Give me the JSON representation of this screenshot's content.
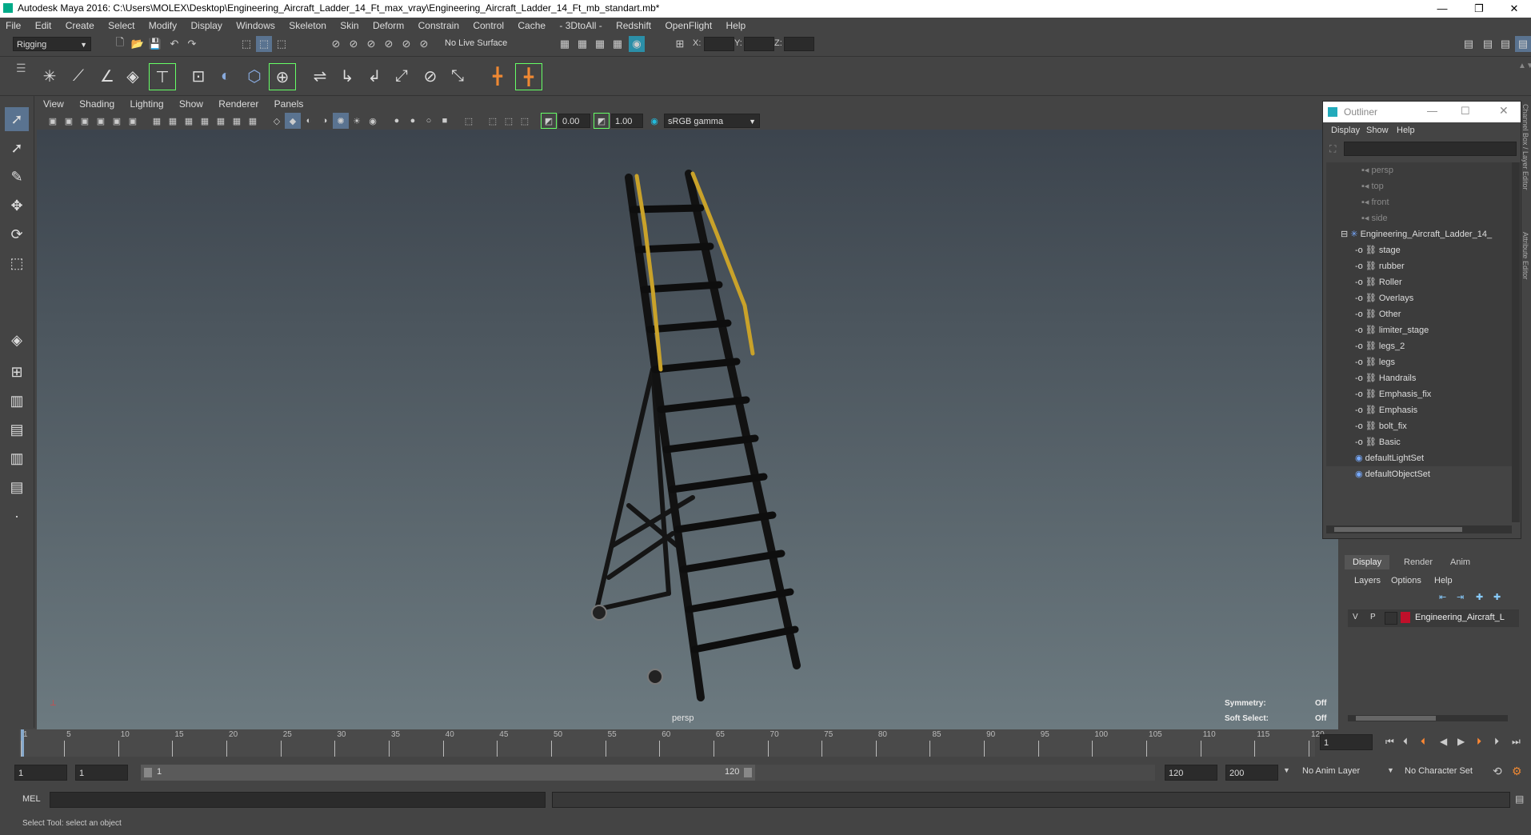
{
  "window": {
    "title": "Autodesk Maya 2016: C:\\Users\\MOLEX\\Desktop\\Engineering_Aircraft_Ladder_14_Ft_max_vray\\Engineering_Aircraft_Ladder_14_Ft_mb_standart.mb*",
    "minimize": "—",
    "restore": "❐",
    "close": "✕"
  },
  "menubar": [
    "File",
    "Edit",
    "Create",
    "Select",
    "Modify",
    "Display",
    "Windows",
    "Skeleton",
    "Skin",
    "Deform",
    "Constrain",
    "Control",
    "Cache",
    "- 3DtoAll -",
    "Redshift",
    "OpenFlight",
    "Help"
  ],
  "statusline": {
    "menuset": "Rigging",
    "live_surface": "No Live Surface",
    "x_label": "X:",
    "y_label": "Y:",
    "z_label": "Z:"
  },
  "panel": {
    "menus": [
      "View",
      "Shading",
      "Lighting",
      "Show",
      "Renderer",
      "Panels"
    ],
    "exposure": "0.00",
    "gamma": "1.00",
    "colorspace": "sRGB gamma"
  },
  "viewport": {
    "camera": "persp",
    "symmetry_label": "Symmetry:",
    "symmetry_value": "Off",
    "soft_select_label": "Soft Select:",
    "soft_select_value": "Off"
  },
  "outliner": {
    "title": "Outliner",
    "menus": [
      "Display",
      "Show",
      "Help"
    ],
    "cameras": [
      "persp",
      "top",
      "front",
      "side"
    ],
    "group": "Engineering_Aircraft_Ladder_14_",
    "children": [
      "stage",
      "rubber",
      "Roller",
      "Overlays",
      "Other",
      "limiter_stage",
      "legs_2",
      "legs",
      "Handrails",
      "Emphasis_fix",
      "Emphasis",
      "bolt_fix",
      "Basic"
    ],
    "sets": [
      "defaultLightSet",
      "defaultObjectSet"
    ]
  },
  "side_tabs": [
    "Channel Box / Layer Editor",
    "Attribute Editor"
  ],
  "layers": {
    "tabs": [
      "Display",
      "Render",
      "Anim"
    ],
    "menus": [
      "Layers",
      "Options",
      "Help"
    ],
    "row_v": "V",
    "row_p": "P",
    "layer_name": "Engineering_Aircraft_L",
    "layer_color": "#c0102a"
  },
  "timeline": {
    "ticks": [
      "1",
      "5",
      "10",
      "15",
      "20",
      "25",
      "30",
      "35",
      "40",
      "45",
      "50",
      "55",
      "60",
      "65",
      "70",
      "75",
      "80",
      "85",
      "90",
      "95",
      "100",
      "105",
      "110",
      "115",
      "120"
    ],
    "current_frame": "1"
  },
  "range": {
    "start": "1",
    "playback_start": "1",
    "slider_start": "1",
    "slider_end": "120",
    "playback_end": "120",
    "end": "200",
    "anim_layer": "No Anim Layer",
    "character_set": "No Character Set"
  },
  "cmdline": {
    "label": "MEL"
  },
  "helpline": {
    "text": "Select Tool: select an object"
  }
}
